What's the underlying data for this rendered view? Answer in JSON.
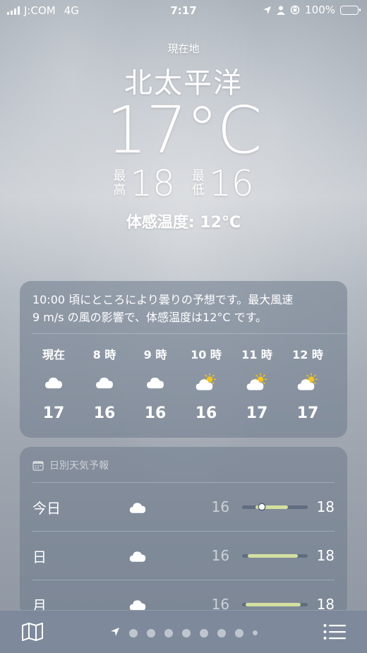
{
  "status_bar": {
    "carrier": "J:COM",
    "network": "4G",
    "time": "7:17",
    "battery": "100%"
  },
  "location": {
    "label": "現在地",
    "city": "北太平洋"
  },
  "current": {
    "temp": "17°C",
    "high_label": "最高",
    "high": "18",
    "low_label": "最低",
    "low": "16",
    "feels_like": "体感温度: 12°C"
  },
  "hourly": {
    "summary_line1": "10:00 頃にところにより曇りの予想です。最大風速",
    "summary_line2": "9 m/s の風の影響で、体感温度は12°C です。",
    "items": [
      {
        "label": "現在",
        "icon": "cloud-icon",
        "temp": "17"
      },
      {
        "label": "8 時",
        "icon": "cloud-icon",
        "temp": "16"
      },
      {
        "label": "9 時",
        "icon": "cloud-icon",
        "temp": "16"
      },
      {
        "label": "10 時",
        "icon": "partly-cloudy-icon",
        "temp": "16"
      },
      {
        "label": "11 時",
        "icon": "partly-cloudy-icon",
        "temp": "17"
      },
      {
        "label": "12 時",
        "icon": "partly-cloudy-icon",
        "temp": "17"
      }
    ]
  },
  "daily": {
    "header": "日別天気予報",
    "rows": [
      {
        "day": "今日",
        "icon": "cloud-icon",
        "low": "16",
        "high": "18",
        "range_start": 0.2,
        "range_end": 0.7,
        "current_pos": 0.3
      },
      {
        "day": "日",
        "icon": "cloud-icon",
        "low": "16",
        "high": "18",
        "range_start": 0.08,
        "range_end": 0.85
      },
      {
        "day": "月",
        "icon": "cloud-icon",
        "low": "16",
        "high": "18",
        "range_start": 0.05,
        "range_end": 0.9
      }
    ]
  },
  "bottom_bar": {
    "page_count": 9,
    "map_icon": "map-icon",
    "list_icon": "list-icon"
  },
  "colors": {
    "temp_bar": "#d3e0a0",
    "sun": "#f5c518"
  }
}
